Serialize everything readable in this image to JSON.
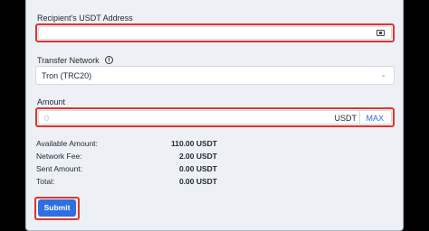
{
  "form": {
    "recipient_label": "Recipient's USDT Address",
    "recipient_value": "",
    "network_label": "Transfer Network",
    "network_selected": "Tron (TRC20)",
    "amount_label": "Amount",
    "amount_placeholder": "0",
    "amount_unit": "USDT",
    "max_label": "MAX",
    "submit_label": "Submit"
  },
  "summary": [
    {
      "label": "Available Amount:",
      "value": "110.00 USDT"
    },
    {
      "label": "Network Fee:",
      "value": "2.00 USDT"
    },
    {
      "label": "Sent Amount:",
      "value": "0.00 USDT"
    },
    {
      "label": "Total:",
      "value": "0.00 USDT"
    }
  ],
  "icons": {
    "address_book": "address-card-icon",
    "info": "info-icon",
    "dropdown": "chevron-down-icon"
  },
  "colors": {
    "highlight": "#e0352b",
    "accent": "#2f6fe0",
    "panel_bg": "#edf1f6"
  }
}
